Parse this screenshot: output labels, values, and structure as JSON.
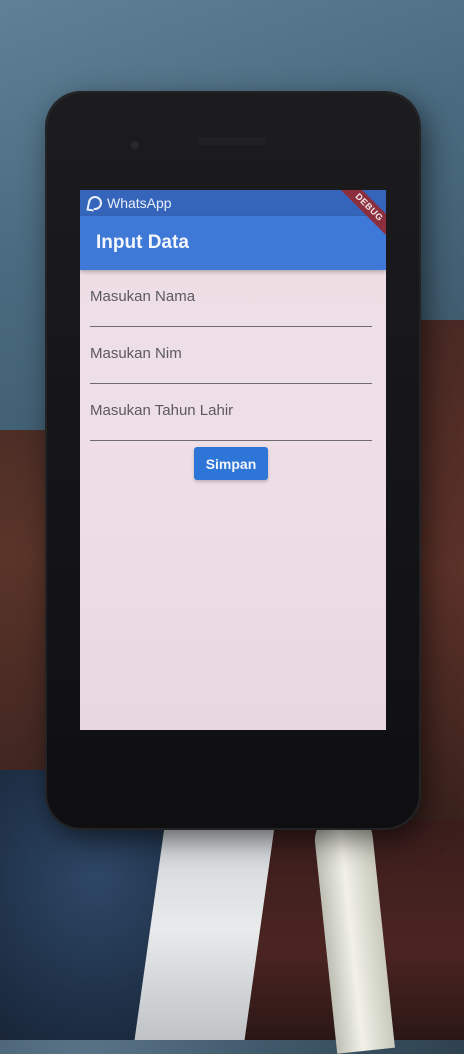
{
  "status_bar": {
    "notification_app": "WhatsApp",
    "notification_icon": "whatsapp-icon"
  },
  "app_bar": {
    "title": "Input Data",
    "background": "#3f79d7"
  },
  "debug_banner": "DEBUG",
  "form": {
    "fields": [
      {
        "placeholder": "Masukan Nama",
        "value": ""
      },
      {
        "placeholder": "Masukan Nim",
        "value": ""
      },
      {
        "placeholder": "Masukan Tahun Lahir",
        "value": ""
      }
    ],
    "submit_label": "Simpan",
    "submit_color": "#2d75d6"
  }
}
